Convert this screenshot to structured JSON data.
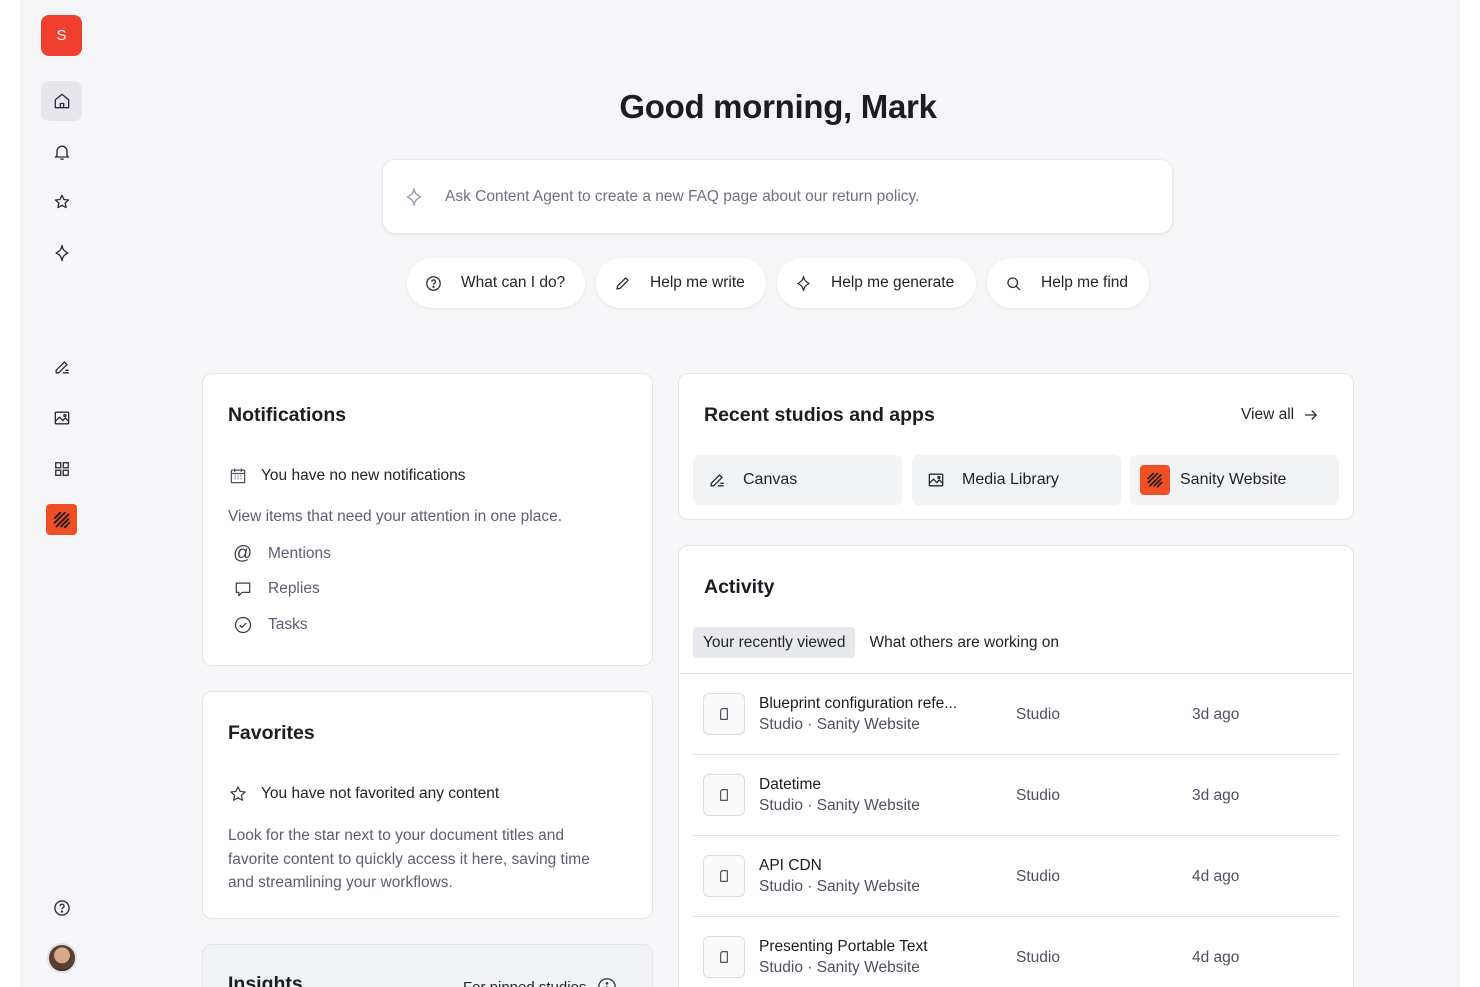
{
  "sidebar": {
    "logo_letter": "S",
    "nav": [
      "home-icon",
      "bell-icon",
      "star-icon",
      "sparkle-icon",
      "canvas-icon",
      "media-library-icon",
      "grid-icon",
      "sanity-website-icon",
      "help-icon"
    ]
  },
  "greeting": "Good morning, Mark",
  "ask": {
    "placeholder": "Ask Content Agent to create a new FAQ page about our return policy."
  },
  "chips": [
    {
      "label": "What can I do?",
      "icon": "help-circle-icon"
    },
    {
      "label": "Help me write",
      "icon": "pencil-icon"
    },
    {
      "label": "Help me generate",
      "icon": "sparkle-icon"
    },
    {
      "label": "Help me find",
      "icon": "search-icon"
    }
  ],
  "notifications": {
    "title": "Notifications",
    "empty": "You have no new notifications",
    "description": "View items that need your attention in one place.",
    "items": [
      "Mentions",
      "Replies",
      "Tasks"
    ]
  },
  "favorites": {
    "title": "Favorites",
    "empty": "You have not favorited any content",
    "description_lines": [
      "Look for the star next to your document titles and",
      "favorite content to quickly access it here, saving time",
      "and streamlining your workflows."
    ]
  },
  "insights": {
    "title": "Insights",
    "filter_label": "For pinned studios"
  },
  "recent": {
    "title": "Recent studios and apps",
    "view_all": "View all",
    "apps": [
      "Canvas",
      "Media Library",
      "Sanity Website"
    ]
  },
  "activity": {
    "title": "Activity",
    "tabs": [
      "Your recently viewed",
      "What others are working on"
    ],
    "rows": [
      {
        "title": "Blueprint configuration refe...",
        "sub": "Studio · Sanity Website",
        "type": "Studio",
        "time": "3d ago"
      },
      {
        "title": "Datetime",
        "sub": "Studio · Sanity Website",
        "type": "Studio",
        "time": "3d ago"
      },
      {
        "title": "API CDN",
        "sub": "Studio · Sanity Website",
        "type": "Studio",
        "time": "4d ago"
      },
      {
        "title": "Presenting Portable Text",
        "sub": "Studio · Sanity Website",
        "type": "Studio",
        "time": "4d ago"
      }
    ]
  },
  "colors": {
    "brand": "#f03e2f",
    "sanity_tile": "#f04e23",
    "background": "#f6f6f8"
  }
}
